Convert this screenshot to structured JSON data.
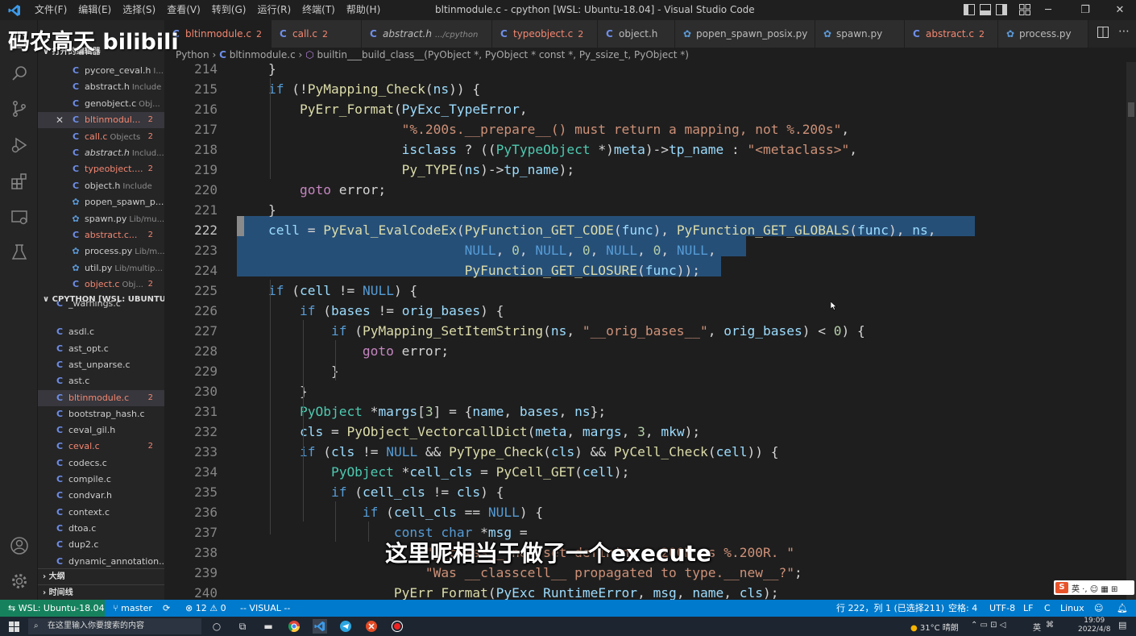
{
  "titlebar": {
    "menu": [
      "文件(F)",
      "编辑(E)",
      "选择(S)",
      "查看(V)",
      "转到(G)",
      "运行(R)",
      "终端(T)",
      "帮助(H)"
    ],
    "title": "bltinmodule.c - cpython [WSL: Ubuntu-18.04] - Visual Studio Code"
  },
  "watermark": "码农高天 bilibili",
  "sidebar": {
    "open_editors_title": "打开的编辑器",
    "open_editors": [
      {
        "name": "pycore_ceval.h",
        "desc": "I...",
        "icon": "C",
        "err": false,
        "italic": false,
        "badge": ""
      },
      {
        "name": "abstract.h",
        "desc": "Include",
        "icon": "C",
        "err": false,
        "italic": false,
        "badge": ""
      },
      {
        "name": "genobject.c",
        "desc": "Obj...",
        "icon": "C",
        "err": false,
        "italic": false,
        "badge": ""
      },
      {
        "name": "bltinmodul...",
        "desc": "",
        "icon": "C",
        "err": true,
        "italic": false,
        "badge": "2"
      },
      {
        "name": "call.c",
        "desc": "Objects",
        "icon": "C",
        "err": true,
        "italic": false,
        "badge": "2"
      },
      {
        "name": "abstract.h",
        "desc": "Includ...",
        "icon": "C",
        "err": false,
        "italic": true,
        "badge": ""
      },
      {
        "name": "typeobject....",
        "desc": "",
        "icon": "C",
        "err": true,
        "italic": false,
        "badge": "2"
      },
      {
        "name": "object.h",
        "desc": "Include",
        "icon": "C",
        "err": false,
        "italic": false,
        "badge": ""
      },
      {
        "name": "popen_spawn_p...",
        "desc": "",
        "icon": "py",
        "err": false,
        "italic": false,
        "badge": ""
      },
      {
        "name": "spawn.py",
        "desc": "Lib/mu...",
        "icon": "py",
        "err": false,
        "italic": false,
        "badge": ""
      },
      {
        "name": "abstract.c...",
        "desc": "",
        "icon": "C",
        "err": true,
        "italic": false,
        "badge": "2"
      },
      {
        "name": "process.py",
        "desc": "Lib/m...",
        "icon": "py",
        "err": false,
        "italic": false,
        "badge": ""
      },
      {
        "name": "util.py",
        "desc": "Lib/multip...",
        "icon": "py",
        "err": false,
        "italic": false,
        "badge": ""
      },
      {
        "name": "object.c",
        "desc": "Obj...",
        "icon": "C",
        "err": true,
        "italic": false,
        "badge": "2"
      }
    ],
    "folder_title": "CPYTHON [WSL: UBUNTU-...",
    "files": [
      {
        "name": "_warnings.c",
        "err": false,
        "badge": ""
      },
      {
        "name": "asdl.c",
        "err": false,
        "badge": ""
      },
      {
        "name": "ast_opt.c",
        "err": false,
        "badge": ""
      },
      {
        "name": "ast_unparse.c",
        "err": false,
        "badge": ""
      },
      {
        "name": "ast.c",
        "err": false,
        "badge": ""
      },
      {
        "name": "bltinmodule.c",
        "err": true,
        "badge": "2"
      },
      {
        "name": "bootstrap_hash.c",
        "err": false,
        "badge": ""
      },
      {
        "name": "ceval_gil.h",
        "err": false,
        "badge": ""
      },
      {
        "name": "ceval.c",
        "err": true,
        "badge": "2"
      },
      {
        "name": "codecs.c",
        "err": false,
        "badge": ""
      },
      {
        "name": "compile.c",
        "err": false,
        "badge": ""
      },
      {
        "name": "condvar.h",
        "err": false,
        "badge": ""
      },
      {
        "name": "context.c",
        "err": false,
        "badge": ""
      },
      {
        "name": "dtoa.c",
        "err": false,
        "badge": ""
      },
      {
        "name": "dup2.c",
        "err": false,
        "badge": ""
      },
      {
        "name": "dynamic_annotation...",
        "err": false,
        "badge": ""
      }
    ],
    "outline_title": "大纲",
    "timeline_title": "时间线"
  },
  "tabs": [
    {
      "label": "bltinmodule.c",
      "desc": "",
      "badge": "2",
      "icon": "C",
      "err": true,
      "italic": false,
      "active": true
    },
    {
      "label": "call.c",
      "desc": "",
      "badge": "2",
      "icon": "C",
      "err": true,
      "italic": false,
      "active": false
    },
    {
      "label": "abstract.h",
      "desc": ".../cpython",
      "badge": "",
      "icon": "C",
      "err": false,
      "italic": true,
      "active": false
    },
    {
      "label": "typeobject.c",
      "desc": "",
      "badge": "2",
      "icon": "C",
      "err": true,
      "italic": false,
      "active": false
    },
    {
      "label": "object.h",
      "desc": "",
      "badge": "",
      "icon": "C",
      "err": false,
      "italic": false,
      "active": false
    },
    {
      "label": "popen_spawn_posix.py",
      "desc": "",
      "badge": "",
      "icon": "py",
      "err": false,
      "italic": false,
      "active": false
    },
    {
      "label": "spawn.py",
      "desc": "",
      "badge": "",
      "icon": "py",
      "err": false,
      "italic": false,
      "active": false
    },
    {
      "label": "abstract.c",
      "desc": "",
      "badge": "2",
      "icon": "C",
      "err": true,
      "italic": false,
      "active": false
    },
    {
      "label": "process.py",
      "desc": "",
      "badge": "",
      "icon": "py",
      "err": false,
      "italic": false,
      "active": false
    }
  ],
  "breadcrumb": {
    "folder": "Python",
    "file": "bltinmodule.c",
    "symbol": "builtin___build_class__(PyObject *, PyObject * const *, Py_ssize_t, PyObject *)"
  },
  "editor": {
    "current_line": 222,
    "lines": [
      {
        "n": "214",
        "tokens": [
          [
            "p",
            "    }"
          ]
        ]
      },
      {
        "n": "215",
        "tokens": [
          [
            "k",
            "    if"
          ],
          [
            "p",
            " (!"
          ],
          [
            "f",
            "PyMapping_Check"
          ],
          [
            "p",
            "("
          ],
          [
            "v",
            "ns"
          ],
          [
            "p",
            ")) {"
          ]
        ]
      },
      {
        "n": "216",
        "tokens": [
          [
            "f",
            "        PyErr_Format"
          ],
          [
            "p",
            "("
          ],
          [
            "v",
            "PyExc_TypeError"
          ],
          [
            "p",
            ","
          ]
        ]
      },
      {
        "n": "217",
        "tokens": [
          [
            "s",
            "                     \"%.200s.__prepare__() must return a mapping, not %.200s\""
          ],
          [
            "p",
            ","
          ]
        ]
      },
      {
        "n": "218",
        "tokens": [
          [
            "v",
            "                     isclass"
          ],
          [
            "p",
            " ? (("
          ],
          [
            "t",
            "PyTypeObject"
          ],
          [
            "p",
            " *)"
          ],
          [
            "v",
            "meta"
          ],
          [
            "p",
            ")->"
          ],
          [
            "v",
            "tp_name"
          ],
          [
            "p",
            " : "
          ],
          [
            "s",
            "\"<metaclass>\""
          ],
          [
            "p",
            ","
          ]
        ]
      },
      {
        "n": "219",
        "tokens": [
          [
            "f",
            "                     Py_TYPE"
          ],
          [
            "p",
            "("
          ],
          [
            "v",
            "ns"
          ],
          [
            "p",
            ")->"
          ],
          [
            "v",
            "tp_name"
          ],
          [
            "p",
            ");"
          ]
        ]
      },
      {
        "n": "220",
        "tokens": [
          [
            "cf",
            "        goto"
          ],
          [
            "p",
            " error;"
          ]
        ]
      },
      {
        "n": "221",
        "tokens": [
          [
            "p",
            "    }"
          ]
        ]
      },
      {
        "n": "222",
        "tokens": [
          [
            "v",
            "    cell"
          ],
          [
            "p",
            " = "
          ],
          [
            "f",
            "PyEval_EvalCodeEx"
          ],
          [
            "p",
            "("
          ],
          [
            "f",
            "PyFunction_GET_CODE"
          ],
          [
            "p",
            "("
          ],
          [
            "v",
            "func"
          ],
          [
            "p",
            "), "
          ],
          [
            "f",
            "PyFunction_GET_GLOBALS"
          ],
          [
            "p",
            "("
          ],
          [
            "v",
            "func"
          ],
          [
            "p",
            "), "
          ],
          [
            "v",
            "ns"
          ],
          [
            "p",
            ","
          ]
        ]
      },
      {
        "n": "223",
        "tokens": [
          [
            "k",
            "                             NULL"
          ],
          [
            "p",
            ", "
          ],
          [
            "n",
            "0"
          ],
          [
            "p",
            ", "
          ],
          [
            "k",
            "NULL"
          ],
          [
            "p",
            ", "
          ],
          [
            "n",
            "0"
          ],
          [
            "p",
            ", "
          ],
          [
            "k",
            "NULL"
          ],
          [
            "p",
            ", "
          ],
          [
            "n",
            "0"
          ],
          [
            "p",
            ", "
          ],
          [
            "k",
            "NULL"
          ],
          [
            "p",
            ","
          ]
        ]
      },
      {
        "n": "224",
        "tokens": [
          [
            "f",
            "                             PyFunction_GET_CLOSURE"
          ],
          [
            "p",
            "("
          ],
          [
            "v",
            "func"
          ],
          [
            "p",
            "));"
          ]
        ]
      },
      {
        "n": "225",
        "tokens": [
          [
            "k",
            "    if"
          ],
          [
            "p",
            " ("
          ],
          [
            "v",
            "cell"
          ],
          [
            "p",
            " != "
          ],
          [
            "k",
            "NULL"
          ],
          [
            "p",
            ") {"
          ]
        ]
      },
      {
        "n": "226",
        "tokens": [
          [
            "k",
            "        if"
          ],
          [
            "p",
            " ("
          ],
          [
            "v",
            "bases"
          ],
          [
            "p",
            " != "
          ],
          [
            "v",
            "orig_bases"
          ],
          [
            "p",
            ") {"
          ]
        ]
      },
      {
        "n": "227",
        "tokens": [
          [
            "k",
            "            if"
          ],
          [
            "p",
            " ("
          ],
          [
            "f",
            "PyMapping_SetItemString"
          ],
          [
            "p",
            "("
          ],
          [
            "v",
            "ns"
          ],
          [
            "p",
            ", "
          ],
          [
            "s",
            "\"__orig_bases__\""
          ],
          [
            "p",
            ", "
          ],
          [
            "v",
            "orig_bases"
          ],
          [
            "p",
            ") < "
          ],
          [
            "n",
            "0"
          ],
          [
            "p",
            ") {"
          ]
        ]
      },
      {
        "n": "228",
        "tokens": [
          [
            "cf",
            "                goto"
          ],
          [
            "p",
            " error;"
          ]
        ]
      },
      {
        "n": "229",
        "tokens": [
          [
            "p",
            "            }"
          ]
        ]
      },
      {
        "n": "230",
        "tokens": [
          [
            "p",
            "        }"
          ]
        ]
      },
      {
        "n": "231",
        "tokens": [
          [
            "t",
            "        PyObject"
          ],
          [
            "p",
            " *"
          ],
          [
            "v",
            "margs"
          ],
          [
            "p",
            "["
          ],
          [
            "n",
            "3"
          ],
          [
            "p",
            "] = {"
          ],
          [
            "v",
            "name"
          ],
          [
            "p",
            ", "
          ],
          [
            "v",
            "bases"
          ],
          [
            "p",
            ", "
          ],
          [
            "v",
            "ns"
          ],
          [
            "p",
            "};"
          ]
        ]
      },
      {
        "n": "232",
        "tokens": [
          [
            "v",
            "        cls"
          ],
          [
            "p",
            " = "
          ],
          [
            "f",
            "PyObject_VectorcallDict"
          ],
          [
            "p",
            "("
          ],
          [
            "v",
            "meta"
          ],
          [
            "p",
            ", "
          ],
          [
            "v",
            "margs"
          ],
          [
            "p",
            ", "
          ],
          [
            "n",
            "3"
          ],
          [
            "p",
            ", "
          ],
          [
            "v",
            "mkw"
          ],
          [
            "p",
            ");"
          ]
        ]
      },
      {
        "n": "233",
        "tokens": [
          [
            "k",
            "        if"
          ],
          [
            "p",
            " ("
          ],
          [
            "v",
            "cls"
          ],
          [
            "p",
            " != "
          ],
          [
            "k",
            "NULL"
          ],
          [
            "p",
            " && "
          ],
          [
            "f",
            "PyType_Check"
          ],
          [
            "p",
            "("
          ],
          [
            "v",
            "cls"
          ],
          [
            "p",
            ") && "
          ],
          [
            "f",
            "PyCell_Check"
          ],
          [
            "p",
            "("
          ],
          [
            "v",
            "cell"
          ],
          [
            "p",
            ")) {"
          ]
        ]
      },
      {
        "n": "234",
        "tokens": [
          [
            "t",
            "            PyObject"
          ],
          [
            "p",
            " *"
          ],
          [
            "v",
            "cell_cls"
          ],
          [
            "p",
            " = "
          ],
          [
            "f",
            "PyCell_GET"
          ],
          [
            "p",
            "("
          ],
          [
            "v",
            "cell"
          ],
          [
            "p",
            ");"
          ]
        ]
      },
      {
        "n": "235",
        "tokens": [
          [
            "k",
            "            if"
          ],
          [
            "p",
            " ("
          ],
          [
            "v",
            "cell_cls"
          ],
          [
            "p",
            " != "
          ],
          [
            "v",
            "cls"
          ],
          [
            "p",
            ") {"
          ]
        ]
      },
      {
        "n": "236",
        "tokens": [
          [
            "k",
            "                if"
          ],
          [
            "p",
            " ("
          ],
          [
            "v",
            "cell_cls"
          ],
          [
            "p",
            " == "
          ],
          [
            "k",
            "NULL"
          ],
          [
            "p",
            ") {"
          ]
        ]
      },
      {
        "n": "237",
        "tokens": [
          [
            "k",
            "                    const"
          ],
          [
            "k",
            " char"
          ],
          [
            "p",
            " *"
          ],
          [
            "v",
            "msg"
          ],
          [
            "p",
            " ="
          ]
        ]
      },
      {
        "n": "238",
        "tokens": [
          [
            "s",
            "                        \"__class__ not set defining %.200R as %.200R. \""
          ]
        ]
      },
      {
        "n": "239",
        "tokens": [
          [
            "s",
            "                        \"Was __classcell__ propagated to type.__new__?\""
          ],
          [
            "p",
            ";"
          ]
        ]
      },
      {
        "n": "240",
        "tokens": [
          [
            "f",
            "                    PyErr_Format"
          ],
          [
            "p",
            "("
          ],
          [
            "v",
            "PyExc_RuntimeError"
          ],
          [
            "p",
            ", "
          ],
          [
            "v",
            "msg"
          ],
          [
            "p",
            ", "
          ],
          [
            "v",
            "name"
          ],
          [
            "p",
            ", "
          ],
          [
            "v",
            "cls"
          ],
          [
            "p",
            ");"
          ]
        ]
      }
    ]
  },
  "subtitle": "这里呢相当于做了一个execute",
  "ime": "英 ·, ☺ ▦ ⊞",
  "statusbar": {
    "remote": "WSL: Ubuntu-18.04",
    "branch": "master",
    "problems": "⊗ 12 ⚠ 0",
    "mode": "-- VISUAL --",
    "position": "行 222，列 1 (已选择211)",
    "spaces": "空格: 4",
    "encoding": "UTF-8",
    "eol": "LF",
    "language_mode": "C",
    "os": "Linux"
  },
  "taskbar": {
    "search_placeholder": "在这里输入你要搜索的内容",
    "weather": "31°C 晴朗",
    "time": "19:09",
    "date": "2022/4/8",
    "lang": "英"
  },
  "colors": {
    "statusbar": "#007acc",
    "remote": "#16825d",
    "selection": "#264f78",
    "error": "#f48771"
  }
}
